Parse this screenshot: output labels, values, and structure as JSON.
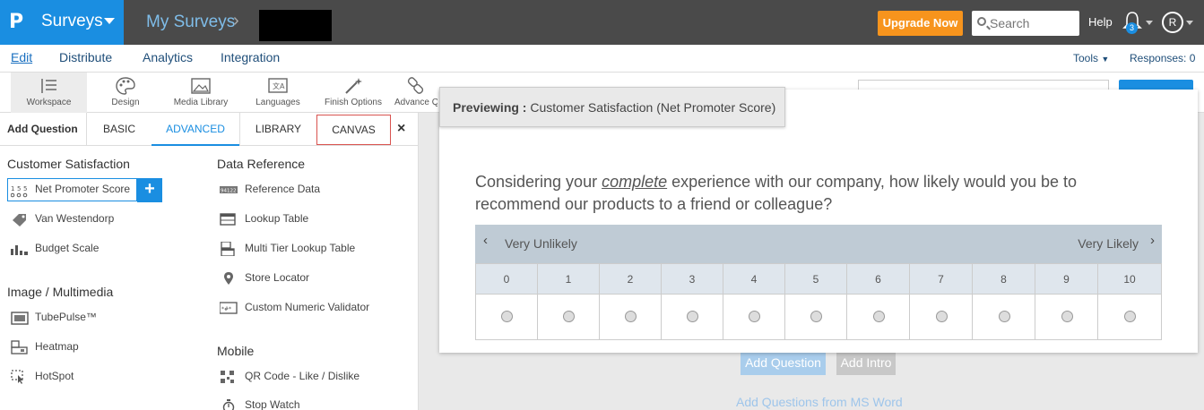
{
  "topbar": {
    "logo": "P",
    "app_name": "Surveys",
    "breadcrumb": "My Surveys",
    "upgrade_label": "Upgrade Now",
    "search_placeholder": "Search",
    "help_label": "Help",
    "notification_count": "3",
    "avatar_initial": "R"
  },
  "nav": {
    "items": [
      "Edit",
      "Distribute",
      "Analytics",
      "Integration"
    ],
    "tools_label": "Tools",
    "responses_label": "Responses: 0"
  },
  "toolbar": {
    "items": [
      "Workspace",
      "Design",
      "Media Library",
      "Languages",
      "Finish Options",
      "Advance Q"
    ]
  },
  "left_panel": {
    "tabs": [
      "Add Question",
      "BASIC",
      "ADVANCED",
      "LIBRARY",
      "CANVAS"
    ],
    "sections": {
      "customer_satisfaction": {
        "title": "Customer Satisfaction",
        "items": [
          "Net Promoter Score",
          "Van Westendorp",
          "Budget Scale"
        ]
      },
      "image_multimedia": {
        "title": "Image / Multimedia",
        "items": [
          "TubePulse™",
          "Heatmap",
          "HotSpot"
        ]
      },
      "data_reference": {
        "title": "Data Reference",
        "items": [
          "Reference Data",
          "Lookup Table",
          "Multi Tier Lookup Table",
          "Store Locator",
          "Custom Numeric Validator"
        ]
      },
      "mobile": {
        "title": "Mobile",
        "items": [
          "QR Code - Like / Dislike",
          "Stop Watch"
        ]
      }
    }
  },
  "preview": {
    "label": "Previewing :",
    "title": "Customer Satisfaction (Net Promoter Score)",
    "question_before": "Considering your ",
    "question_emph": "complete",
    "question_after": " experience with our company, how likely would you be to recommend our products to a friend or colleague?",
    "low_label": "Very Unlikely",
    "high_label": "Very Likely",
    "scale": [
      "0",
      "1",
      "2",
      "3",
      "4",
      "5",
      "6",
      "7",
      "8",
      "9",
      "10"
    ]
  },
  "actions": {
    "add_question": "Add Question",
    "add_intro": "Add Intro",
    "add_ms_word": "Add Questions from MS Word"
  }
}
